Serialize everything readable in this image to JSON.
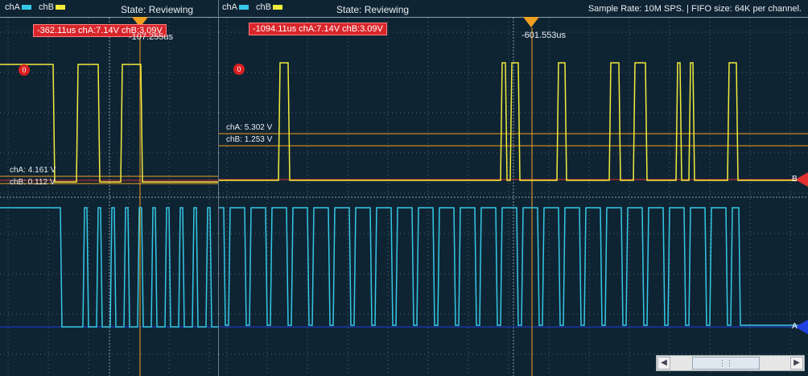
{
  "left_panel": {
    "legend": {
      "cha_label": "chA",
      "chb_label": "chB",
      "cha_color": "#35c8e6",
      "chb_color": "#f1ec3c"
    },
    "state": "State: Reviewing",
    "readout": "-362.11us chA:7.14V  chB:3.09V",
    "marker_label": "0",
    "cursor_time": "-107.255us",
    "cursor_cha": "chA: 4.161 V",
    "cursor_chb": "chB: 0.112 V"
  },
  "right_panel": {
    "legend": {
      "cha_label": "chA",
      "chb_label": "chB"
    },
    "state": "State: Reviewing",
    "sample_rate": "Sample Rate: 10M SPS. | FIFO size:  64K per channel.",
    "readout": "-1094.11us chA:7.14V  chB:3.09V",
    "marker_label": "0",
    "cursor_time": "-601.553us",
    "cursor_cha": "chA: 5.302 V",
    "cursor_chb": "chB: 1.253 V",
    "channel_b_marker": "B",
    "channel_a_marker": "A"
  },
  "colors": {
    "background": "#0f2433",
    "grid": "#4b6470",
    "cha": "#35c8e6",
    "chb": "#f1ec3c",
    "cursor": "#f0a020",
    "ref_b": "#e03030",
    "ref_a": "#2040e0"
  },
  "scrollbar": {
    "left_icon": "chevron-left-icon",
    "right_icon": "chevron-right-icon",
    "thumb_icon": "grip-icon"
  }
}
